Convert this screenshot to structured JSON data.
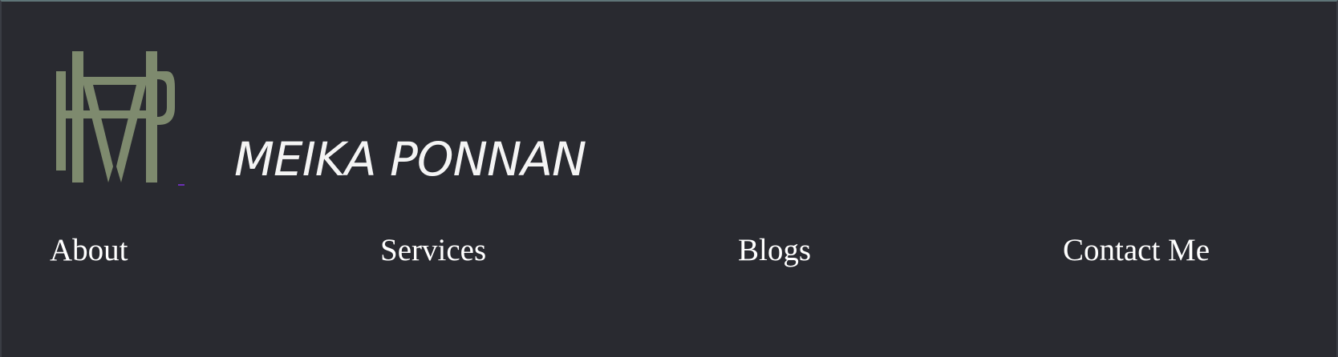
{
  "header": {
    "logo": {
      "icon": "mp-monogram-icon",
      "color": "#7e8a6e"
    },
    "brand_name": "MEIKA PONNAN"
  },
  "nav": {
    "items": [
      {
        "label": "About"
      },
      {
        "label": "Services"
      },
      {
        "label": "Blogs"
      },
      {
        "label": "Contact Me"
      }
    ]
  },
  "colors": {
    "background": "#292a30",
    "text": "#ffffff",
    "logo": "#7e8a6e",
    "link_underline": "#6a2fb5"
  }
}
